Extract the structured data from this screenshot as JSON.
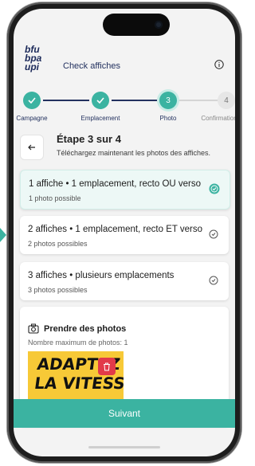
{
  "header": {
    "logo_lines": [
      "bfu",
      "bpa",
      "upi"
    ],
    "title": "Check affiches",
    "info_icon": "info-icon"
  },
  "stepper": {
    "steps": [
      {
        "label": "Campagne",
        "state": "done",
        "number": ""
      },
      {
        "label": "Emplacement",
        "state": "done",
        "number": ""
      },
      {
        "label": "Photo",
        "state": "current",
        "number": "3"
      },
      {
        "label": "Confirmation",
        "state": "todo",
        "number": "4"
      }
    ]
  },
  "section": {
    "title": "Étape 3 sur 4",
    "subtitle": "Téléchargez maintenant les photos des affiches."
  },
  "options": [
    {
      "title": "1 affiche • 1 emplacement, recto OU verso",
      "subtitle": "1 photo possible",
      "selected": true
    },
    {
      "title": "2 affiches • 1 emplacement, recto ET verso",
      "subtitle": "2 photos possibles",
      "selected": false
    },
    {
      "title": "3 affiches • plusieurs emplacements",
      "subtitle": "3 photos possibles",
      "selected": false
    }
  ],
  "photos": {
    "title": "Prendre des photos",
    "max_label": "Nombre maximum de photos: 1",
    "poster_lines": [
      "ADAPTEZ",
      "LA VITESSE"
    ]
  },
  "footer": {
    "next_label": "Suivant"
  },
  "colors": {
    "accent": "#3bb3a1",
    "navy": "#23315f",
    "delete": "#e23a49",
    "poster": "#f7c937"
  }
}
